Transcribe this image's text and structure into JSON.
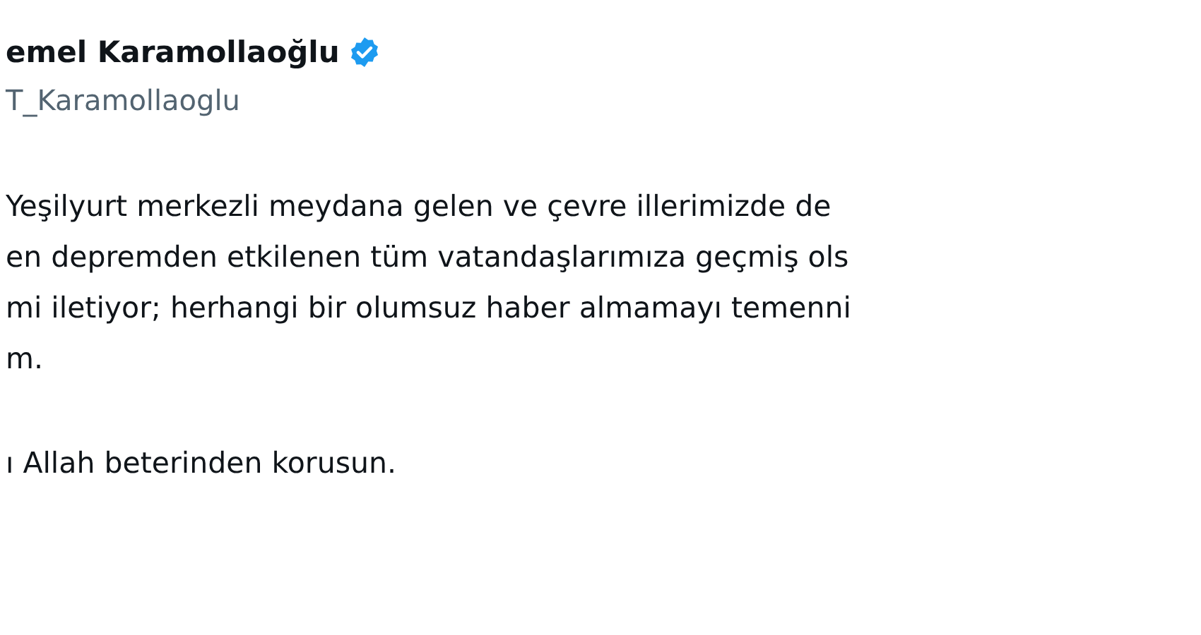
{
  "author": {
    "name": "emel Karamollaoğlu",
    "verified": true,
    "handle": "T_Karamollaoglu"
  },
  "paragraphs": [
    {
      "lines": [
        "Yeşilyurt merkezli meydana gelen ve çevre illerimizde de",
        "en depremden etkilenen tüm vatandaşlarımıza geçmiş ols",
        "mi iletiyor; herhangi bir olumsuz haber almamayı temenni",
        "m."
      ]
    },
    {
      "lines": [
        "ı Allah beterinden korusun."
      ]
    }
  ]
}
